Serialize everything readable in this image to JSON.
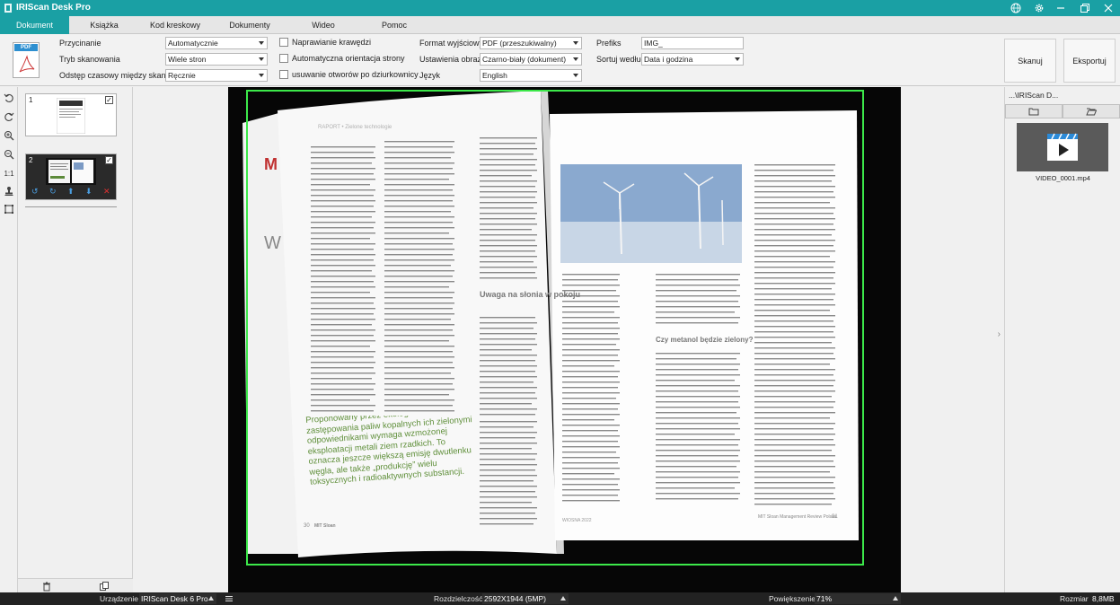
{
  "app": {
    "title": "IRIScan Desk Pro"
  },
  "tabs": [
    "Dokument",
    "Książka",
    "Kod kreskowy",
    "Dokumenty tożsamości",
    "Wideo",
    "Pomoc"
  ],
  "active_tab": "Dokument",
  "output_icon_label": "PDF",
  "options": {
    "crop": {
      "label": "Przycinanie",
      "value": "Automatycznie"
    },
    "scan_mode": {
      "label": "Tryb skanowania",
      "value": "Wiele stron"
    },
    "interval": {
      "label": "Odstęp czasowy między skanami",
      "value": "Ręcznie"
    },
    "fix_edges": {
      "label": "Naprawianie krawędzi",
      "checked": false
    },
    "auto_orient": {
      "label": "Automatyczna orientacja strony",
      "checked": false
    },
    "remove_holes": {
      "label": "usuwanie otworów po dziurkownicy",
      "checked": false
    },
    "output_format": {
      "label": "Format wyjściowy",
      "value": "PDF (przeszukiwalny)"
    },
    "image_settings": {
      "label": "Ustawienia obrazu",
      "value": "Czarno-biały (dokument)"
    },
    "language": {
      "label": "Język",
      "value": "English"
    },
    "prefix": {
      "label": "Prefiks",
      "value": "IMG_"
    },
    "sort_by": {
      "label": "Sortuj według",
      "value": "Data i godzina"
    }
  },
  "buttons": {
    "scan": "Skanuj",
    "export": "Eksportuj"
  },
  "thumbnails": [
    {
      "number": "1",
      "checked": true
    },
    {
      "number": "2",
      "checked": true
    }
  ],
  "tools": {
    "fit": "1:1"
  },
  "right_panel": {
    "path": "...\\IRIScan D...",
    "video_file": "VIDEO_0001.mp4"
  },
  "status": {
    "device_label": "Urządzenie",
    "device_value": "IRIScan Desk 6 Pro",
    "resolution_label": "Rozdzielczość",
    "resolution_value": "2592X1944 (5MP)",
    "zoom_label": "Powiększenie",
    "zoom_value": "71%",
    "size_label": "Rozmiar",
    "size_value": "8,8MB"
  },
  "colors": {
    "accent": "#1aa0a4",
    "crop_frame": "#3ce84a"
  },
  "magazine": {
    "left_header": "RAPORT • Zielone technologie",
    "subheading": "Uwaga na słonia w pokoju",
    "pull_quote": "Proponowany przez ekologów model zastępowania paliw kopalnych ich zielonymi odpowiednikami wymaga wzmożonej eksploatacji metali ziem rzadkich. To oznacza jeszcze większą emisję dwutlenku węgla, ale także „produkcję” wielu toksycznych i radioaktywnych substancji.",
    "right_subheading": "Czy metanol będzie zielony?",
    "left_page_number": "30",
    "right_page_number": "31",
    "footer_brand": "MIT Sloan",
    "footer_right": "MIT Sloan Management Review Polska",
    "footer_date": "WIOSNA 2022"
  }
}
